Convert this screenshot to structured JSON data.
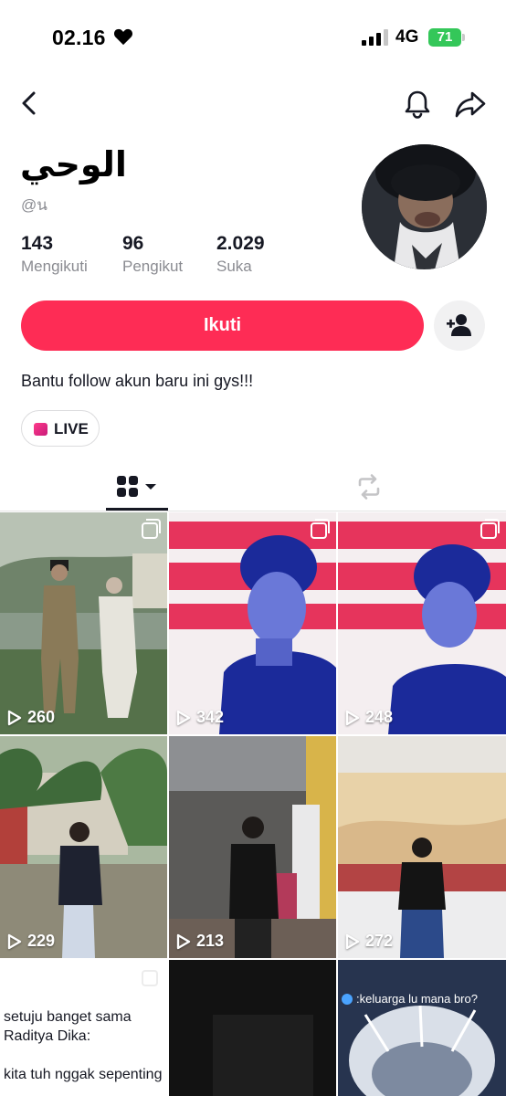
{
  "status_bar": {
    "time": "02.16",
    "network": "4G",
    "battery": "71"
  },
  "profile": {
    "display_name": "الوحي",
    "handle": "@น",
    "stats": [
      {
        "value": "143",
        "label": "Mengikuti"
      },
      {
        "value": "96",
        "label": "Pengikut"
      },
      {
        "value": "2.029",
        "label": "Suka"
      }
    ],
    "follow_label": "Ikuti",
    "bio": "Bantu follow akun baru ini gys!!!",
    "live_label": "LIVE"
  },
  "colors": {
    "accent": "#fe2c55",
    "battery": "#34c759",
    "text": "#161823",
    "muted": "#8a8b91"
  },
  "icons": [
    "back-icon",
    "bell-icon",
    "share-icon",
    "add-friend-icon",
    "grid-icon",
    "repost-icon",
    "play-icon",
    "multi-photo-icon",
    "heart-icon"
  ],
  "videos": [
    {
      "views": "260"
    },
    {
      "views": "342"
    },
    {
      "views": "248"
    },
    {
      "views": "229"
    },
    {
      "views": "213"
    },
    {
      "views": "272"
    }
  ],
  "text_post": {
    "line1": "setuju banget sama",
    "line2": "Raditya Dika:",
    "line3": "kita tuh nggak sepenting"
  },
  "caption_post": {
    "caption": ":keluarga lu mana bro?"
  }
}
